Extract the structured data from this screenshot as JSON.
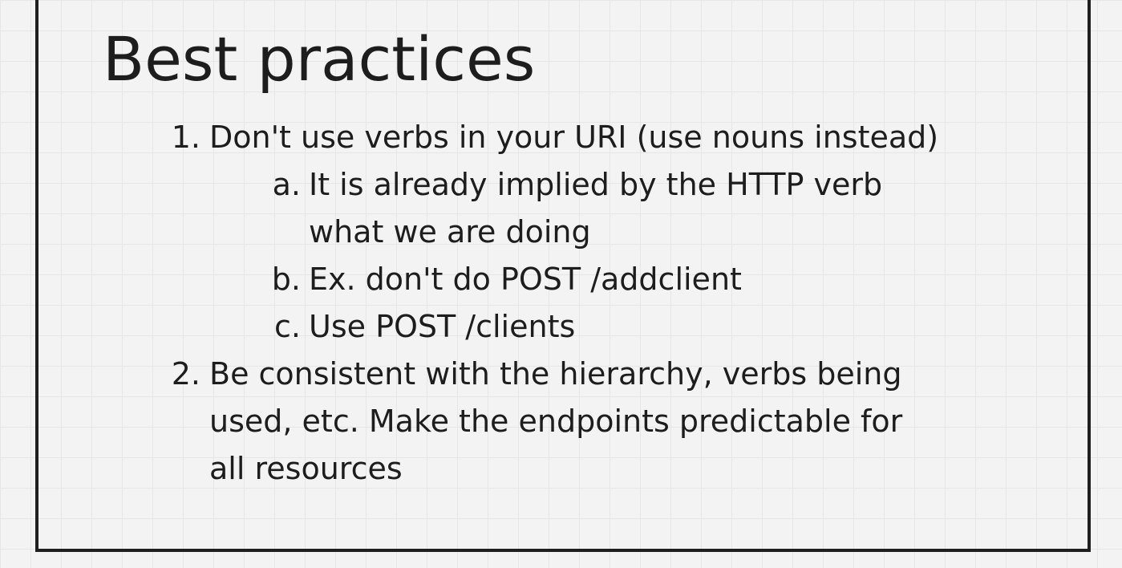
{
  "slide": {
    "title": "Best practices",
    "list": [
      {
        "marker": "1.",
        "lines": [
          "Don't use verbs in your URI (use nouns instead)"
        ],
        "sub": [
          {
            "marker": "a.",
            "lines": [
              "It is already implied by the HTTP verb",
              "what we are doing"
            ]
          },
          {
            "marker": "b.",
            "lines": [
              "Ex. don't do POST /addclient"
            ]
          },
          {
            "marker": "c.",
            "lines": [
              "Use POST /clients"
            ]
          }
        ]
      },
      {
        "marker": "2.",
        "lines": [
          "Be consistent with the hierarchy, verbs being",
          "used, etc. Make the endpoints predictable for",
          "all resources"
        ]
      }
    ]
  }
}
